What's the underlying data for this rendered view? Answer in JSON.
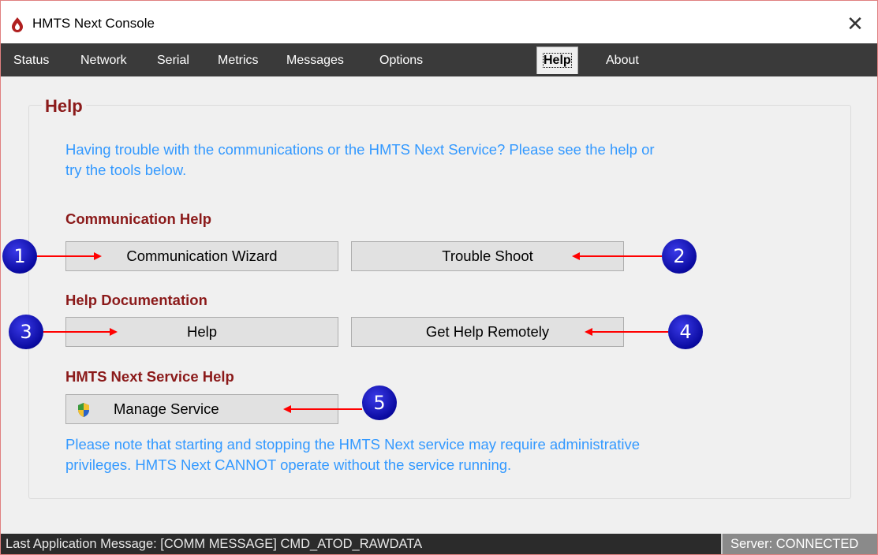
{
  "window": {
    "title": "HMTS Next Console",
    "close_glyph": "✕"
  },
  "tabs": [
    {
      "label": "Status"
    },
    {
      "label": "Network"
    },
    {
      "label": "Serial"
    },
    {
      "label": "Metrics"
    },
    {
      "label": "Messages"
    },
    {
      "label": "Options"
    },
    {
      "label": "Help",
      "active": true
    },
    {
      "label": "About"
    }
  ],
  "help_panel": {
    "title": "Help",
    "intro_line1": "Having trouble with the communications or the HMTS Next Service?  Please see the help or",
    "intro_line2": "try the tools below.",
    "communication_help": {
      "heading": "Communication Help",
      "wizard_button": "Communication Wizard",
      "troubleshoot_button": "Trouble Shoot"
    },
    "help_documentation": {
      "heading": "Help Documentation",
      "help_button": "Help",
      "remote_button": "Get Help Remotely"
    },
    "service_help": {
      "heading": "HMTS Next Service Help",
      "manage_button": "Manage Service",
      "note_line1": "Please note that starting and stopping the HMTS Next service may require administrative",
      "note_line2": "privileges.  HMTS Next CANNOT operate without the service running."
    }
  },
  "callouts": [
    "1",
    "2",
    "3",
    "4",
    "5"
  ],
  "status_bar": {
    "message": "Last Application Message:  [COMM MESSAGE] CMD_ATOD_RAWDATA",
    "server": "Server:  CONNECTED"
  },
  "colors": {
    "heading_red": "#8b1a1a",
    "info_blue": "#3399ff",
    "callout_blue": "#0a0aa0",
    "arrow_red": "#ff0000",
    "tabstrip_bg": "#3a3a3a"
  },
  "icons": {
    "app": "flame-drop-icon",
    "shield": "uac-shield-icon"
  }
}
